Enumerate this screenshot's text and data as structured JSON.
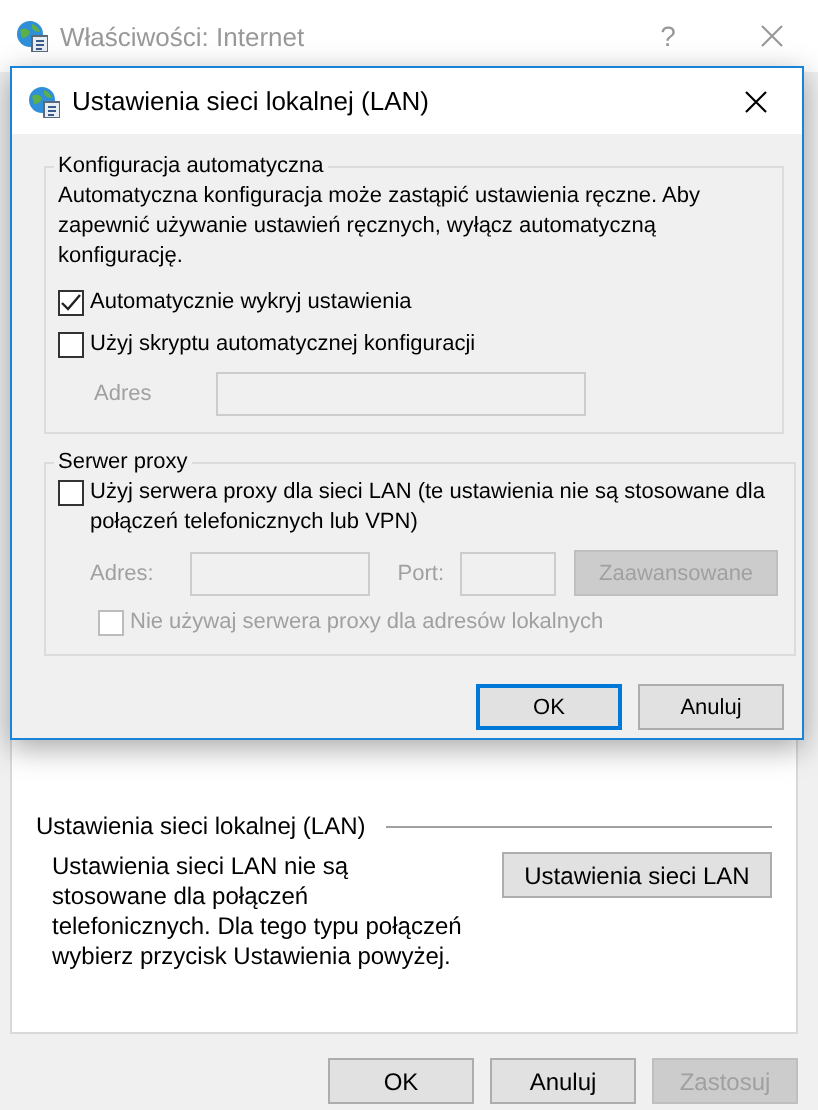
{
  "window": {
    "title": "Właściwości: Internet",
    "help": "?",
    "active": false
  },
  "lan_dialog": {
    "title": "Ustawienia sieci lokalnej (LAN)",
    "auto_config": {
      "title": "Konfiguracja automatyczna",
      "description": "Automatyczna konfiguracja może zastąpić ustawienia ręczne. Aby zapewnić używanie ustawień ręcznych, wyłącz automatyczną konfigurację.",
      "checkboxes": [
        {
          "label": "Automatycznie wykryj ustawienia",
          "checked": true,
          "disabled": false
        },
        {
          "label": "Użyj skryptu automatycznej konfiguracji",
          "checked": false,
          "disabled": false
        }
      ],
      "address": {
        "label": "Adres",
        "disabled": true
      }
    },
    "proxy": {
      "title": "Serwer proxy",
      "use_proxy": {
        "label": "Użyj serwera proxy dla sieci LAN (te ustawienia nie są stosowane dla połączeń telefonicznych lub VPN)",
        "checked": false,
        "disabled": false
      },
      "address": {
        "label": "Adres:",
        "disabled": true
      },
      "port": {
        "label": "Port:",
        "disabled": true
      },
      "advanced_button": {
        "label": "Zaawansowane",
        "disabled": true
      },
      "bypass_local": {
        "label": "Nie używaj serwera proxy dla adresów lokalnych",
        "checked": false,
        "disabled": true
      }
    },
    "buttons": [
      {
        "label": "OK",
        "default": true
      },
      {
        "label": "Anuluj",
        "default": false
      }
    ]
  },
  "lan_section": {
    "title": "Ustawienia sieci lokalnej (LAN)",
    "description": "Ustawienia sieci LAN nie są stosowane dla połączeń telefonicznych. Dla tego typu połączeń wybierz przycisk Ustawienia powyżej.",
    "button": "Ustawienia sieci LAN"
  },
  "buttons": [
    {
      "label": "OK",
      "disabled": false
    },
    {
      "label": "Anuluj",
      "disabled": false
    },
    {
      "label": "Zastosuj",
      "disabled": true
    }
  ]
}
